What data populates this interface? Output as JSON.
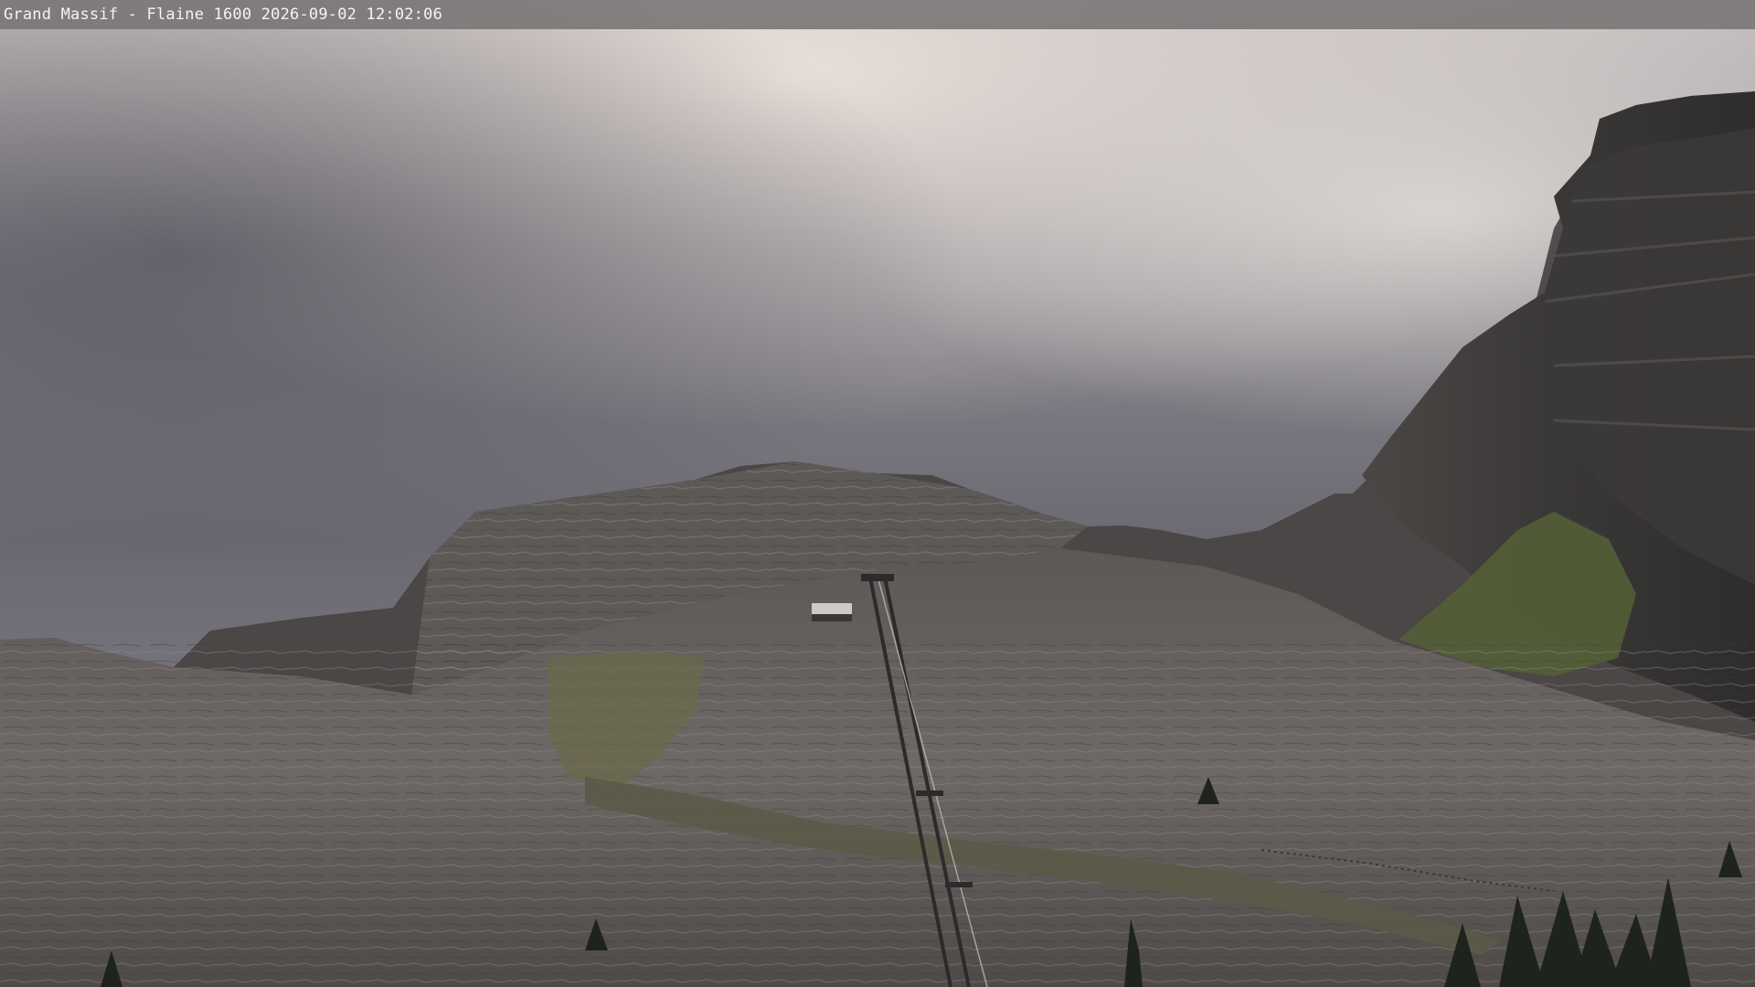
{
  "overlay": {
    "caption": "Grand Massif - Flaine 1600 2026-09-02 12:02:06"
  },
  "scene": {
    "description_icon": "webcam-landscape-image",
    "colors": {
      "sky_dark": "#5d5d63",
      "sky_light": "#d8d2cf",
      "rock_dark": "#3d3a3a",
      "rock_mid": "#6e6a69",
      "grass": "#5f6a3c",
      "overlay_bar": "#787474"
    }
  }
}
